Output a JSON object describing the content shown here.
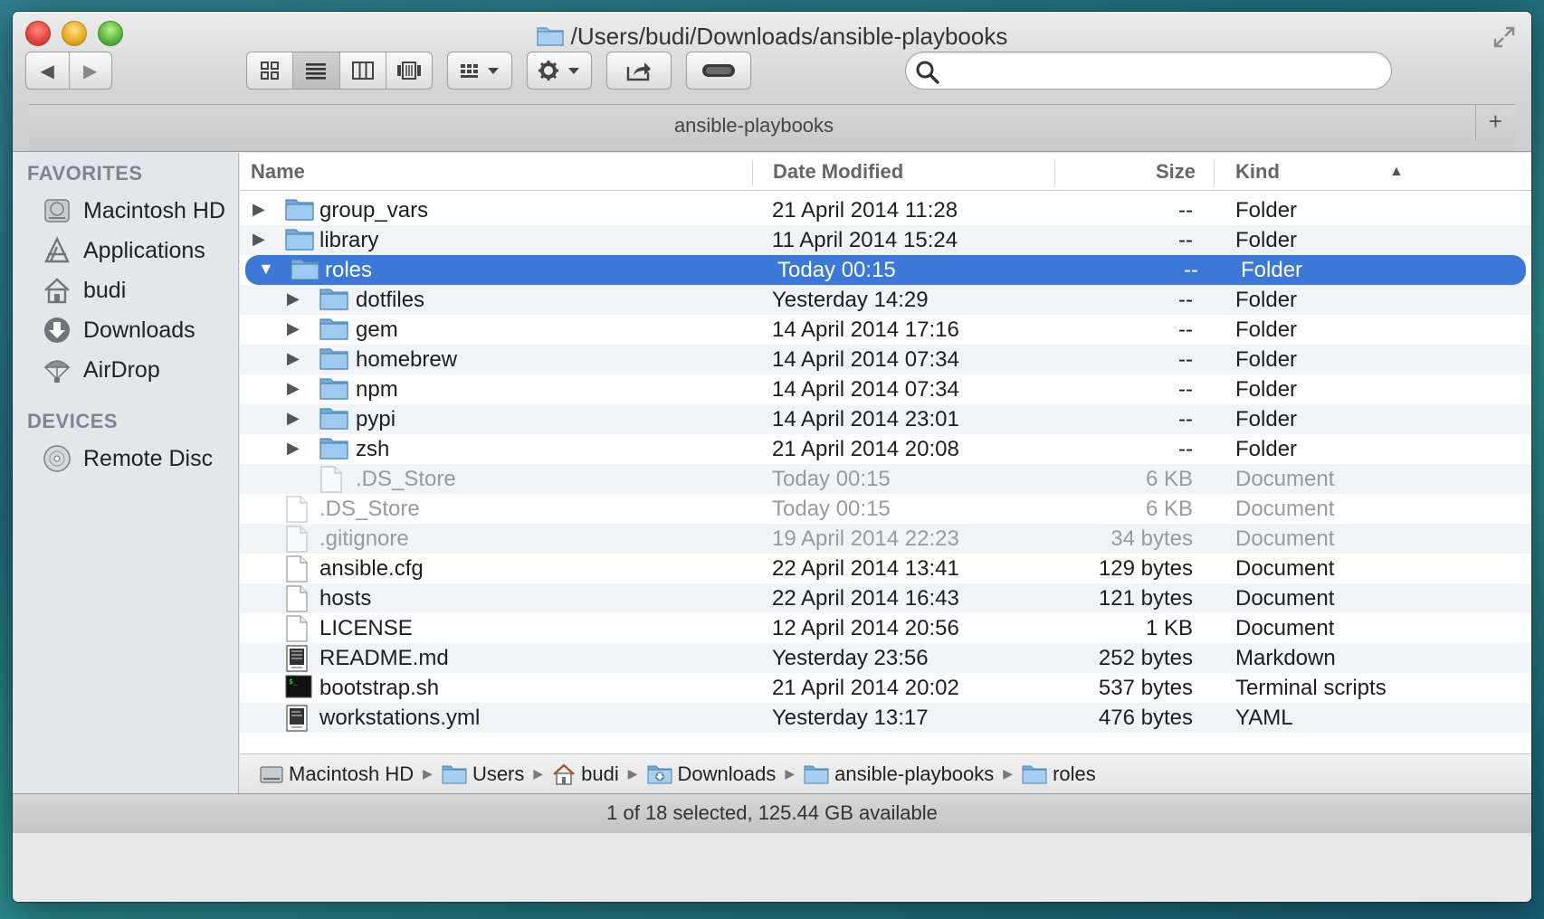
{
  "window": {
    "title": "/Users/budi/Downloads/ansible-playbooks",
    "tab": "ansible-playbooks",
    "tab_add": "+"
  },
  "toolbar": {
    "back_label": "◀",
    "forward_label": "▶",
    "search_placeholder": "",
    "view_modes": [
      "icon-view",
      "list-view",
      "column-view",
      "coverflow-view"
    ],
    "active_view": "list-view"
  },
  "sidebar": {
    "favorites_heading": "FAVORITES",
    "favorites": [
      {
        "label": "Macintosh HD",
        "icon": "hard-drive-icon"
      },
      {
        "label": "Applications",
        "icon": "applications-icon"
      },
      {
        "label": "budi",
        "icon": "home-icon"
      },
      {
        "label": "Downloads",
        "icon": "downloads-icon"
      },
      {
        "label": "AirDrop",
        "icon": "airdrop-icon"
      }
    ],
    "devices_heading": "DEVICES",
    "devices": [
      {
        "label": "Remote Disc",
        "icon": "disc-icon"
      }
    ]
  },
  "columns": {
    "name": "Name",
    "date": "Date Modified",
    "size": "Size",
    "kind": "Kind",
    "sort_indicator": "▲"
  },
  "files": [
    {
      "name": "group_vars",
      "date": "21 April 2014 11:28",
      "size": "--",
      "kind": "Folder",
      "type": "folder",
      "level": 0,
      "expanded": false
    },
    {
      "name": "library",
      "date": "11 April 2014 15:24",
      "size": "--",
      "kind": "Folder",
      "type": "folder",
      "level": 0,
      "expanded": false
    },
    {
      "name": "roles",
      "date": "Today 00:15",
      "size": "--",
      "kind": "Folder",
      "type": "folder",
      "level": 0,
      "expanded": true,
      "selected": true
    },
    {
      "name": "dotfiles",
      "date": "Yesterday 14:29",
      "size": "--",
      "kind": "Folder",
      "type": "folder",
      "level": 1,
      "expanded": false
    },
    {
      "name": "gem",
      "date": "14 April 2014 17:16",
      "size": "--",
      "kind": "Folder",
      "type": "folder",
      "level": 1,
      "expanded": false
    },
    {
      "name": "homebrew",
      "date": "14 April 2014 07:34",
      "size": "--",
      "kind": "Folder",
      "type": "folder",
      "level": 1,
      "expanded": false
    },
    {
      "name": "npm",
      "date": "14 April 2014 07:34",
      "size": "--",
      "kind": "Folder",
      "type": "folder",
      "level": 1,
      "expanded": false
    },
    {
      "name": "pypi",
      "date": "14 April 2014 23:01",
      "size": "--",
      "kind": "Folder",
      "type": "folder",
      "level": 1,
      "expanded": false
    },
    {
      "name": "zsh",
      "date": "21 April 2014 20:08",
      "size": "--",
      "kind": "Folder",
      "type": "folder",
      "level": 1,
      "expanded": false
    },
    {
      "name": ".DS_Store",
      "date": "Today 00:15",
      "size": "6 KB",
      "kind": "Document",
      "type": "doc",
      "level": 1,
      "dim": true
    },
    {
      "name": ".DS_Store",
      "date": "Today 00:15",
      "size": "6 KB",
      "kind": "Document",
      "type": "doc",
      "level": 0,
      "dim": true
    },
    {
      "name": ".gitignore",
      "date": "19 April 2014 22:23",
      "size": "34 bytes",
      "kind": "Document",
      "type": "doc",
      "level": 0,
      "dim": true
    },
    {
      "name": "ansible.cfg",
      "date": "22 April 2014 13:41",
      "size": "129 bytes",
      "kind": "Document",
      "type": "doc",
      "level": 0
    },
    {
      "name": "hosts",
      "date": "22 April 2014 16:43",
      "size": "121 bytes",
      "kind": "Document",
      "type": "doc",
      "level": 0
    },
    {
      "name": "LICENSE",
      "date": "12 April 2014 20:56",
      "size": "1 KB",
      "kind": "Document",
      "type": "doc",
      "level": 0
    },
    {
      "name": "README.md",
      "date": "Yesterday 23:56",
      "size": "252 bytes",
      "kind": "Markdown",
      "type": "markdown",
      "level": 0
    },
    {
      "name": "bootstrap.sh",
      "date": "21 April 2014 20:02",
      "size": "537 bytes",
      "kind": "Terminal scripts",
      "type": "terminal",
      "level": 0
    },
    {
      "name": "workstations.yml",
      "date": "Yesterday 13:17",
      "size": "476 bytes",
      "kind": "YAML",
      "type": "yaml",
      "level": 0
    }
  ],
  "pathbar": [
    {
      "label": "Macintosh HD",
      "icon": "hard-drive-icon"
    },
    {
      "label": "Users",
      "icon": "folder-icon"
    },
    {
      "label": "budi",
      "icon": "home-icon"
    },
    {
      "label": "Downloads",
      "icon": "downloads-folder-icon"
    },
    {
      "label": "ansible-playbooks",
      "icon": "folder-icon"
    },
    {
      "label": "roles",
      "icon": "folder-icon"
    }
  ],
  "status": "1 of 18 selected, 125.44 GB available",
  "colors": {
    "selection": "#3c78d8",
    "folder": "#7fb6e3",
    "sidebar": "#e3e7ec"
  }
}
